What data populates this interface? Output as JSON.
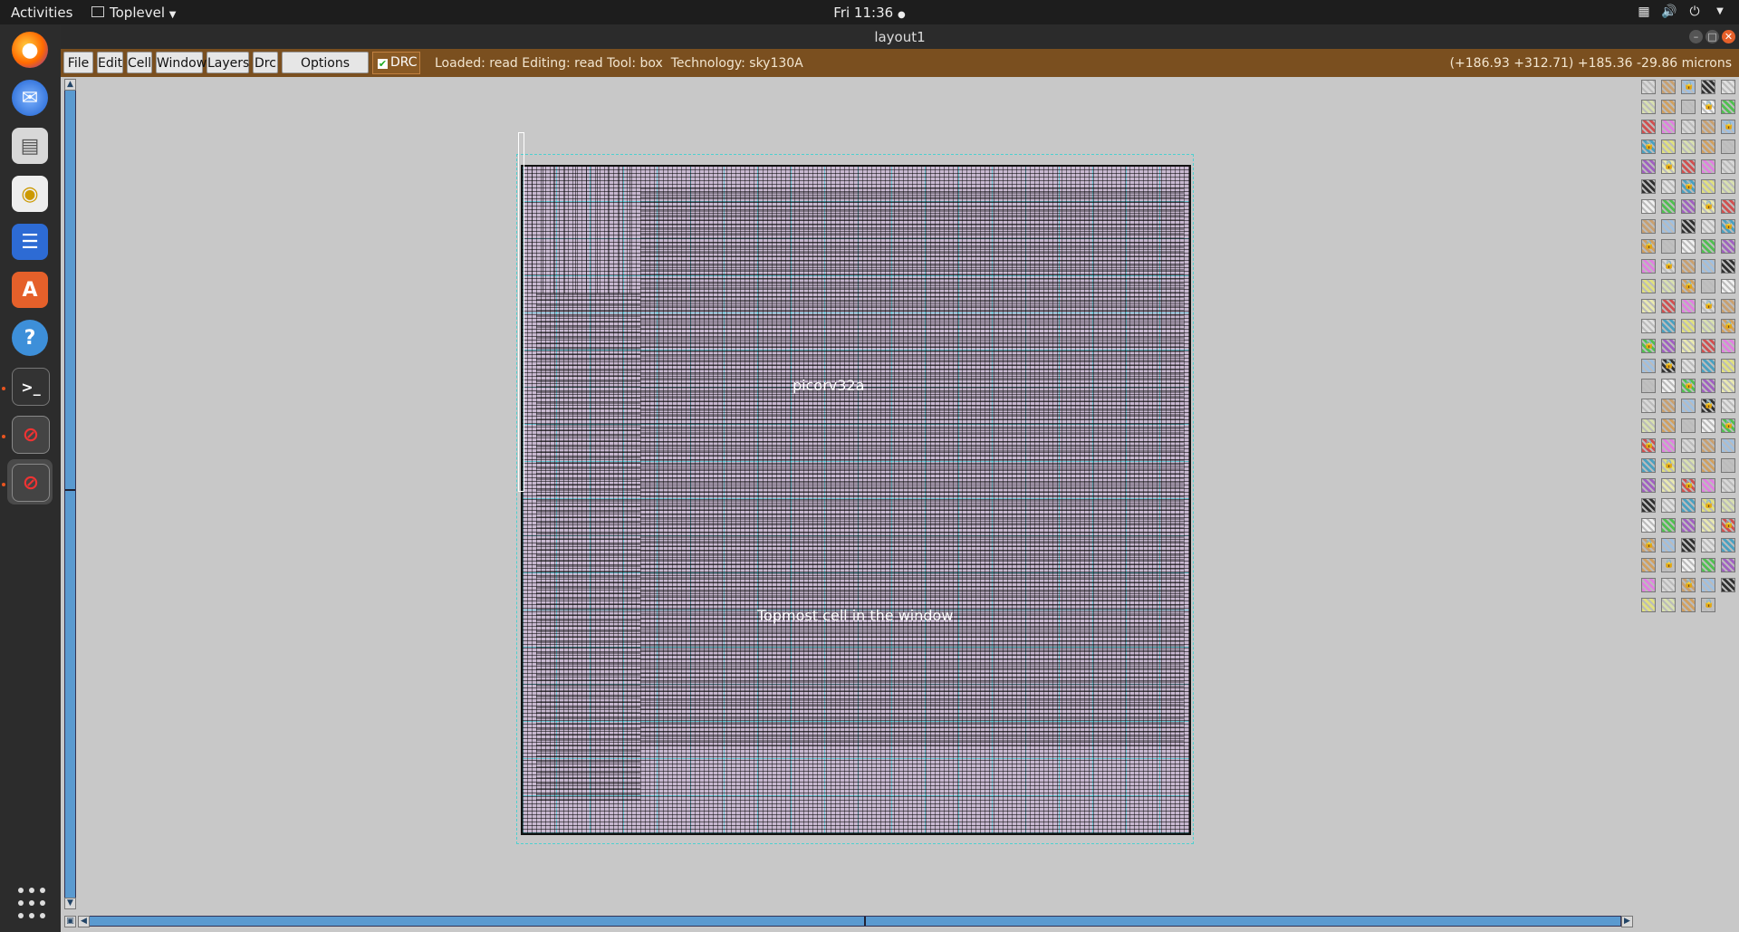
{
  "topbar": {
    "activities": "Activities",
    "app_menu": "Toplevel",
    "clock": "Fri 11:36",
    "icons": [
      "network-icon",
      "volume-icon",
      "power-icon",
      "chevron-down-icon"
    ]
  },
  "dock": {
    "apps": [
      "firefox-icon",
      "thunderbird-icon",
      "files-icon",
      "rhythmbox-icon",
      "libreoffice-writer-icon",
      "software-center-icon",
      "help-icon",
      "terminal-icon",
      "magic-window-icon",
      "magic-window-icon"
    ],
    "show_apps_icon": "app-grid-icon"
  },
  "window": {
    "title": "layout1"
  },
  "menubar": {
    "file": "File",
    "edit": "Edit",
    "cell": "Cell",
    "window": "Window",
    "layers": "Layers",
    "drc": "Drc",
    "options": "Options",
    "drc_toggle": "DRC",
    "status": "Loaded: read Editing: read Tool: box  Technology: sky130A",
    "coords": "(+186.93 +312.71) +185.36 -29.86 microns"
  },
  "layout": {
    "cell_name": "picorv32a",
    "topmost_label": "Topmost cell in the window"
  },
  "colors": {
    "menubar_bg": "#7a4f1f",
    "scrollbar": "#5a9ad0",
    "cell_fill": "#c8b8d0",
    "grid_cyan": "#4fd0d0"
  }
}
